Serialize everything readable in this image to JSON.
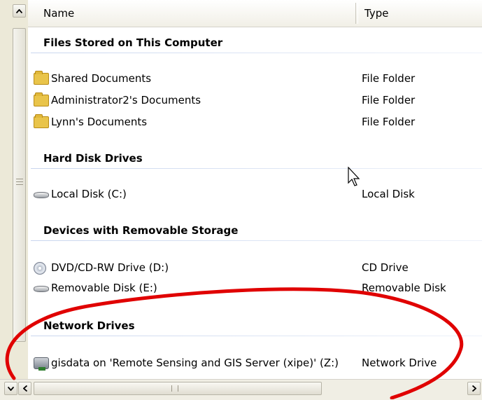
{
  "header": {
    "name_label": "Name",
    "type_label": "Type"
  },
  "groups": [
    {
      "title": "Files Stored on This Computer",
      "items": [
        {
          "name": "Shared Documents",
          "type": "File Folder",
          "icon": "shared-folder-icon"
        },
        {
          "name": "Administrator2's Documents",
          "type": "File Folder",
          "icon": "folder-icon"
        },
        {
          "name": "Lynn's Documents",
          "type": "File Folder",
          "icon": "folder-icon"
        }
      ]
    },
    {
      "title": "Hard Disk Drives",
      "items": [
        {
          "name": "Local Disk (C:)",
          "type": "Local Disk",
          "icon": "hard-drive-icon"
        }
      ]
    },
    {
      "title": "Devices with Removable Storage",
      "items": [
        {
          "name": "DVD/CD-RW Drive (D:)",
          "type": "CD Drive",
          "icon": "cd-drive-icon"
        },
        {
          "name": "Removable Disk (E:)",
          "type": "Removable Disk",
          "icon": "removable-drive-icon"
        }
      ]
    },
    {
      "title": "Network Drives",
      "items": [
        {
          "name": "gisdata on 'Remote Sensing and GIS Server (xipe)' (Z:)",
          "type": "Network Drive",
          "icon": "network-drive-icon"
        }
      ]
    }
  ],
  "colors": {
    "annotation": "#e00000",
    "group_line": "#c9d6ee",
    "folder": "#e9c44a"
  }
}
